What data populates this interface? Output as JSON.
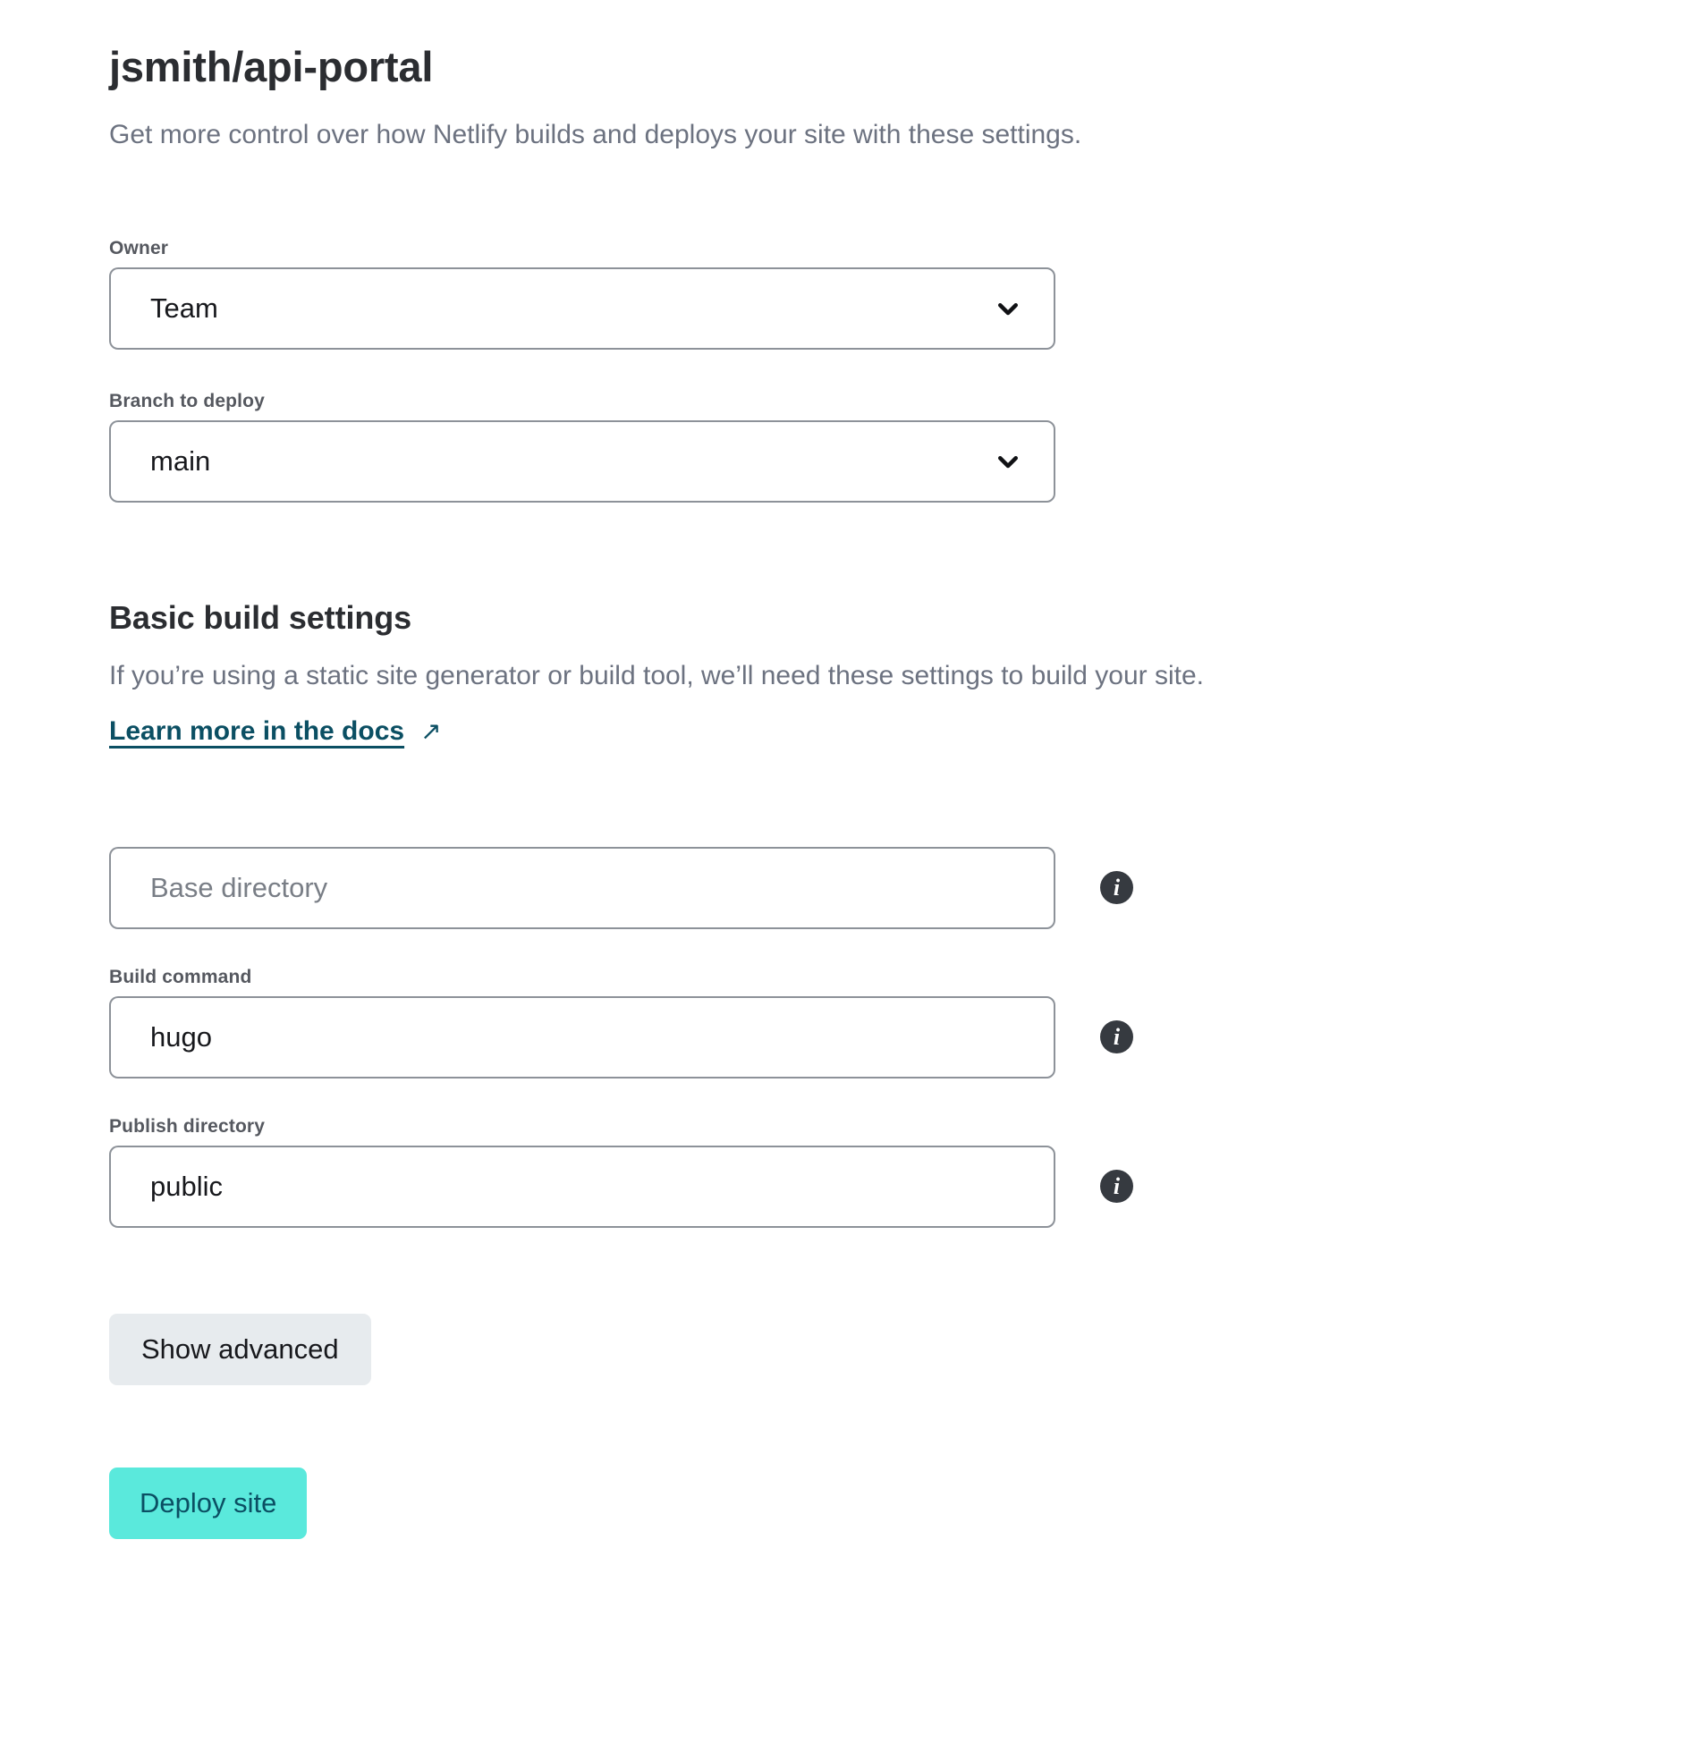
{
  "header": {
    "title": "jsmith/api-portal",
    "subtitle": "Get more control over how Netlify builds and deploys your site with these settings."
  },
  "owner": {
    "label": "Owner",
    "value": "Team",
    "chevron_icon": "chevron-down-icon"
  },
  "branch": {
    "label": "Branch to deploy",
    "value": "main",
    "chevron_icon": "chevron-down-icon"
  },
  "build_settings": {
    "title": "Basic build settings",
    "description": "If you’re using a static site generator or build tool, we’ll need these settings to build your site.",
    "docs_link": "Learn more in the docs",
    "external_icon": "↗",
    "info_icon_glyph": "i"
  },
  "fields": {
    "base_directory": {
      "label": "",
      "placeholder": "Base directory",
      "value": ""
    },
    "build_command": {
      "label": "Build command",
      "placeholder": "Build command",
      "value": "hugo"
    },
    "publish_directory": {
      "label": "Publish directory",
      "placeholder": "Publish directory",
      "value": "public"
    }
  },
  "actions": {
    "show_advanced": "Show advanced",
    "deploy_site": "Deploy site"
  },
  "colors": {
    "primary_button_bg": "#5ae9dc",
    "primary_button_text": "#0b4f63",
    "secondary_button_bg": "#e7ebee",
    "link": "#0b4f63",
    "info_badge": "#363a40",
    "input_border": "#8d9299",
    "muted_text": "#6c7280",
    "label_text": "#55585f"
  }
}
